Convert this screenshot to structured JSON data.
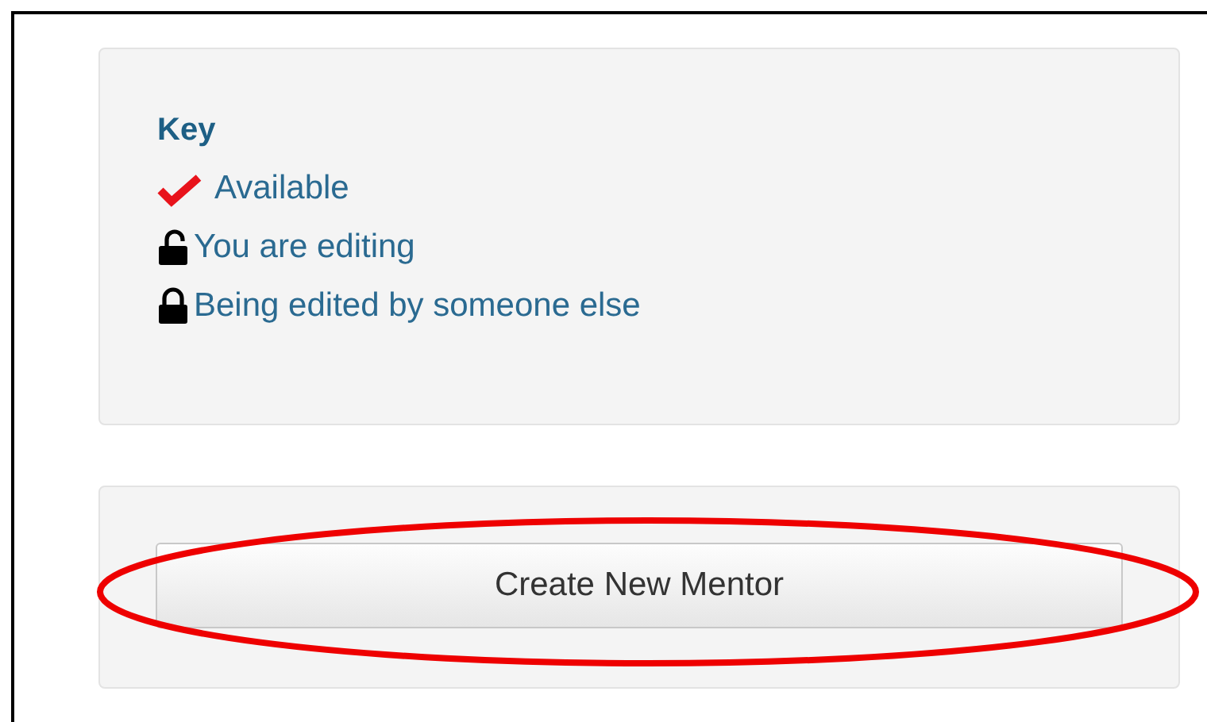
{
  "key_panel": {
    "title": "Key",
    "items": [
      {
        "kind": "check",
        "label": "Available"
      },
      {
        "kind": "unlocked",
        "label": "You are editing"
      },
      {
        "kind": "locked",
        "label": "Being edited by someone else"
      }
    ]
  },
  "action_panel": {
    "button": "Create New Mentor",
    "highlighted": true
  }
}
